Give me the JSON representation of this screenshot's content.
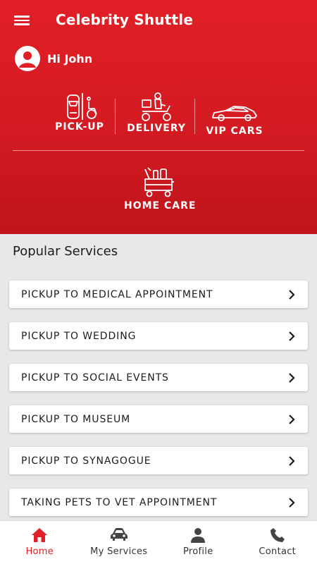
{
  "header": {
    "title": "Celebrity Shuttle",
    "greeting": "Hi John"
  },
  "services": [
    {
      "label": "PICK-UP",
      "icon": "car-wheelchair-icon"
    },
    {
      "label": "DELIVERY",
      "icon": "delivery-scooter-icon"
    },
    {
      "label": "VIP CARS",
      "icon": "sports-car-icon"
    },
    {
      "label": "HOME CARE",
      "icon": "cleaning-cart-icon"
    }
  ],
  "popular": {
    "title": "Popular Services",
    "items": [
      "PICKUP TO MEDICAL APPOINTMENT",
      "PICKUP TO WEDDING",
      "PICKUP TO SOCIAL EVENTS",
      "PICKUP TO MUSEUM",
      "PICKUP TO SYNAGOGUE",
      "TAKING PETS TO VET APPOINTMENT"
    ]
  },
  "nav": [
    {
      "label": "Home",
      "icon": "home-icon",
      "active": true
    },
    {
      "label": "My Services",
      "icon": "car-icon",
      "active": false
    },
    {
      "label": "Profile",
      "icon": "person-icon",
      "active": false
    },
    {
      "label": "Contact",
      "icon": "phone-icon",
      "active": false
    }
  ],
  "colors": {
    "brand": "#e11f26",
    "background": "#e6e9e8"
  }
}
